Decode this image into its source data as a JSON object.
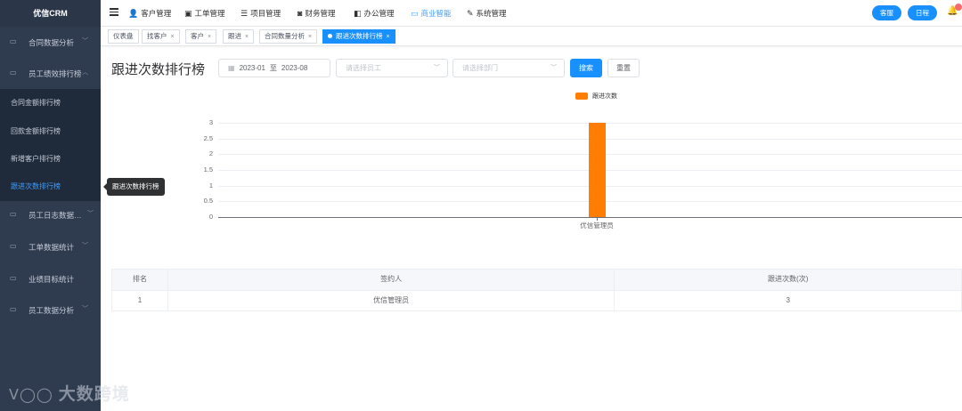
{
  "sidebar": {
    "brand": "优信CRM",
    "menu": [
      {
        "label": "合同数据分析",
        "icon": "monitor-icon"
      },
      {
        "label": "员工绩效排行榜",
        "icon": "monitor-icon"
      },
      {
        "label": "员工日志数据…",
        "icon": "monitor-icon"
      },
      {
        "label": "工单数据统计",
        "icon": "monitor-icon"
      },
      {
        "label": "业绩目标统计",
        "icon": "monitor-icon"
      },
      {
        "label": "员工数据分析",
        "icon": "monitor-icon"
      }
    ],
    "submenu": [
      {
        "label": "合同金额排行榜"
      },
      {
        "label": "回款金额排行榜"
      },
      {
        "label": "新增客户排行榜"
      },
      {
        "label": "跟进次数排行榜"
      }
    ],
    "tooltip": "跟进次数排行榜"
  },
  "watermark": {
    "logo": "ᐯ◯◯",
    "text": "大数跨境"
  },
  "topnav": {
    "items": [
      {
        "label": "客户管理",
        "icon": "users-icon"
      },
      {
        "label": "工单管理",
        "icon": "clipboard-icon"
      },
      {
        "label": "项目管理",
        "icon": "list-icon"
      },
      {
        "label": "财务管理",
        "icon": "wallet-icon"
      },
      {
        "label": "办公管理",
        "icon": "office-icon"
      },
      {
        "label": "商业智能",
        "icon": "chart-icon"
      },
      {
        "label": "系统管理",
        "icon": "wrench-icon"
      }
    ],
    "service_btn": "客服",
    "schedule_btn": "日程"
  },
  "tabs": [
    {
      "label": "仪表盘",
      "closable": false
    },
    {
      "label": "找客户",
      "closable": true
    },
    {
      "label": "客户",
      "closable": true
    },
    {
      "label": "跟进",
      "closable": true
    },
    {
      "label": "合同数量分析",
      "closable": true
    },
    {
      "label": "跟进次数排行榜",
      "closable": true
    }
  ],
  "page": {
    "title": "跟进次数排行榜",
    "date_start": "2023-01",
    "date_sep": "至",
    "date_end": "2023-08",
    "employee_placeholder": "请选择员工",
    "department_placeholder": "请选择部门",
    "search_btn": "搜索",
    "reset_btn": "重置"
  },
  "chart_data": {
    "type": "bar",
    "categories": [
      "优信管理员"
    ],
    "series": [
      {
        "name": "跟进次数",
        "values": [
          3
        ],
        "color": "#ff7d00"
      }
    ],
    "ylim": [
      0,
      3
    ],
    "yticks": [
      "0",
      "0.5",
      "1",
      "1.5",
      "2",
      "2.5",
      "3"
    ],
    "grid": true,
    "legend_position": "top-center"
  },
  "table": {
    "headers": [
      "排名",
      "签约人",
      "跟进次数(次)"
    ],
    "rows": [
      [
        "1",
        "优信管理员",
        "3"
      ]
    ]
  }
}
